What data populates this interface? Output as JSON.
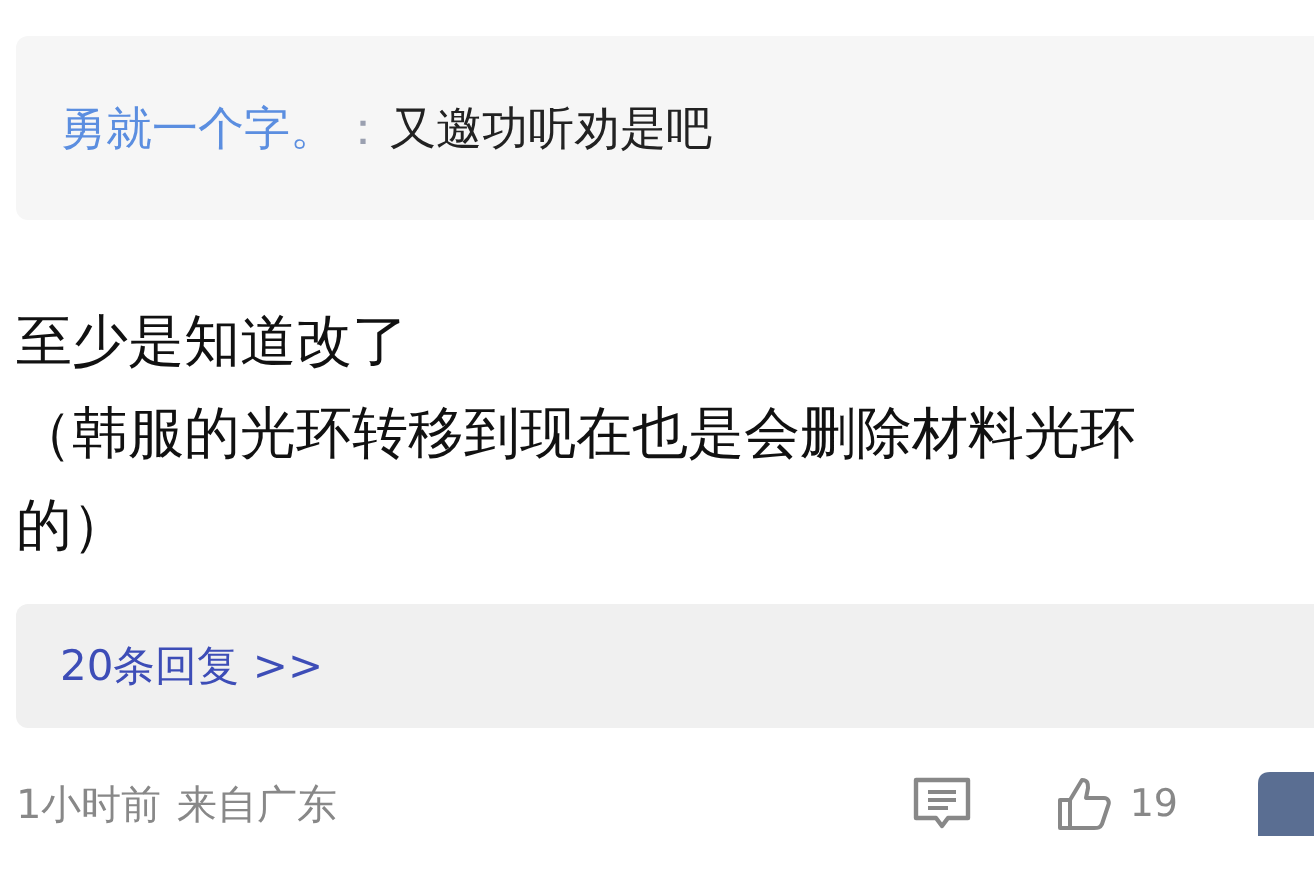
{
  "quoted_reply": {
    "author": "勇就一个字。",
    "separator": "：",
    "text": "又邀功听劝是吧"
  },
  "comment": {
    "lines": [
      "至少是知道改了",
      "（韩服的光环转移到现在也是会删除材料光环的）"
    ]
  },
  "replies_link": {
    "label": "20条回复 >>"
  },
  "footer": {
    "time": "1小时前",
    "location": "来自广东",
    "likes": "19",
    "liked": false
  }
}
